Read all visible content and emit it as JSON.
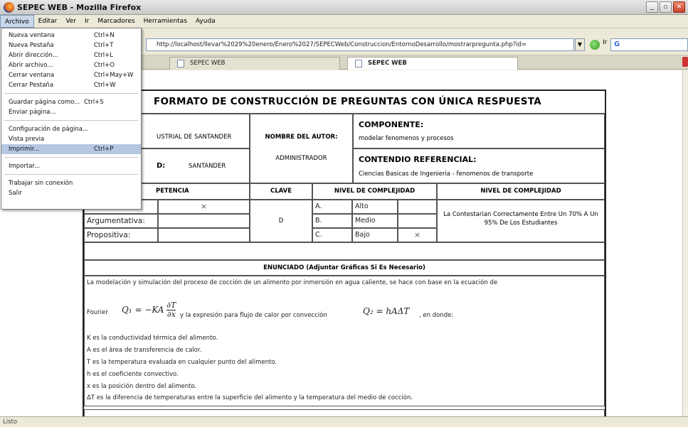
{
  "window": {
    "title": "SEPEC WEB - Mozilla Firefox"
  },
  "menubar": [
    "Archivo",
    "Editar",
    "Ver",
    "Ir",
    "Marcadores",
    "Herramientas",
    "Ayuda"
  ],
  "nav": {
    "url": "http://localhost/llevar%2029%20enero/Enero%2027/SEPECWeb/Construccion/EntornoDesarrollo/mostrarpregunta.php?id=",
    "go_label": "Ir",
    "search_icon": "G"
  },
  "tabs": [
    {
      "label": "SEPEC WEB"
    },
    {
      "label": "SEPEC WEB"
    }
  ],
  "file_menu": {
    "items": [
      {
        "label": "Nueva ventana",
        "shortcut": "Ctrl+N"
      },
      {
        "label": "Nueva Pestaña",
        "shortcut": "Ctrl+T"
      },
      {
        "label": "Abrir dirección...",
        "shortcut": "Ctrl+L"
      },
      {
        "label": "Abrir archivo...",
        "shortcut": "Ctrl+O"
      },
      {
        "label": "Cerrar ventana",
        "shortcut": "Ctrl+May+W"
      },
      {
        "label": "Cerrar Pestaña",
        "shortcut": "Ctrl+W"
      },
      {
        "label": "Guardar página como...",
        "shortcut": "Ctrl+S"
      },
      {
        "label": "Enviar página...",
        "shortcut": ""
      },
      {
        "label": "Configuración de página...",
        "shortcut": ""
      },
      {
        "label": "Vista previa",
        "shortcut": ""
      },
      {
        "label": "Imprimir...",
        "shortcut": "Ctrl+P"
      },
      {
        "label": "Importar...",
        "shortcut": ""
      },
      {
        "label": "Trabajar sin conexión",
        "shortcut": ""
      },
      {
        "label": "Salir",
        "shortcut": ""
      }
    ]
  },
  "form": {
    "title": "FORMATO DE CONSTRUCCIÓN DE PREGUNTAS CON ÚNICA RESPUESTA",
    "institution_partial": "USTRIAL DE SANTANDER",
    "city_label_partial": "D:",
    "city": "SANTANDER",
    "author_label": "NOMBRE DEL AUTOR:",
    "author": "ADMINISTRADOR",
    "component_label": "COMPONENTE:",
    "component": "modelar fenomenos y procesos",
    "reference_label": "CONTENDIO REFERENCIAL:",
    "reference": "Ciencias Basicas de Ingenieria - fenomenos de transporte",
    "competence_header": "PETENCIA",
    "key_header": "CLAVE",
    "level_header": "NIVEL DE COMPLEJIDAD",
    "level_header2": "NIVEL DE COMPLEJIDAD",
    "competences": [
      {
        "label": "",
        "mark": "×"
      },
      {
        "label": "Argumentativa:",
        "mark": ""
      },
      {
        "label": "Propositiva:",
        "mark": ""
      }
    ],
    "key": "D",
    "levels": [
      {
        "letter": "A.",
        "name": "Alto",
        "mark": ""
      },
      {
        "letter": "B.",
        "name": "Medio",
        "mark": ""
      },
      {
        "letter": "C.",
        "name": "Bajo",
        "mark": "×"
      }
    ],
    "level_desc": "La Contestarian Correctamente Entre Un 70% A Un 95% De Los Estudiantes",
    "statement_header": "ENUNCIADO (Adjuntar Gráficas Si Es Necesario)",
    "statement_intro": "La modelación y simulación del proceso de cocción de un alimento por inmersión en agua caliente, se hace con base en la ecuación de",
    "fourier": "Fourier",
    "eq1_lhs": "Q₁ = −KA",
    "eq1_num": "∂T",
    "eq1_den": "∂x",
    "convection_text": "y la expresión para flujo de calor por convección",
    "eq2": "Q₂ = hAΔT",
    "where": ", en donde:",
    "defs": [
      "K es la conductividad térmica del alimento.",
      "A es el área de transferencia de calor.",
      "T es la temperatura evaluada en cualquier punto del alimento.",
      "h es el coeficiente convectivo.",
      "x es la posición dentro del alimento.",
      "ΔT es la diferencia de temperaturas entre la superficie del alimento y la temperatura del medio de cocción."
    ]
  },
  "status": "Listo"
}
